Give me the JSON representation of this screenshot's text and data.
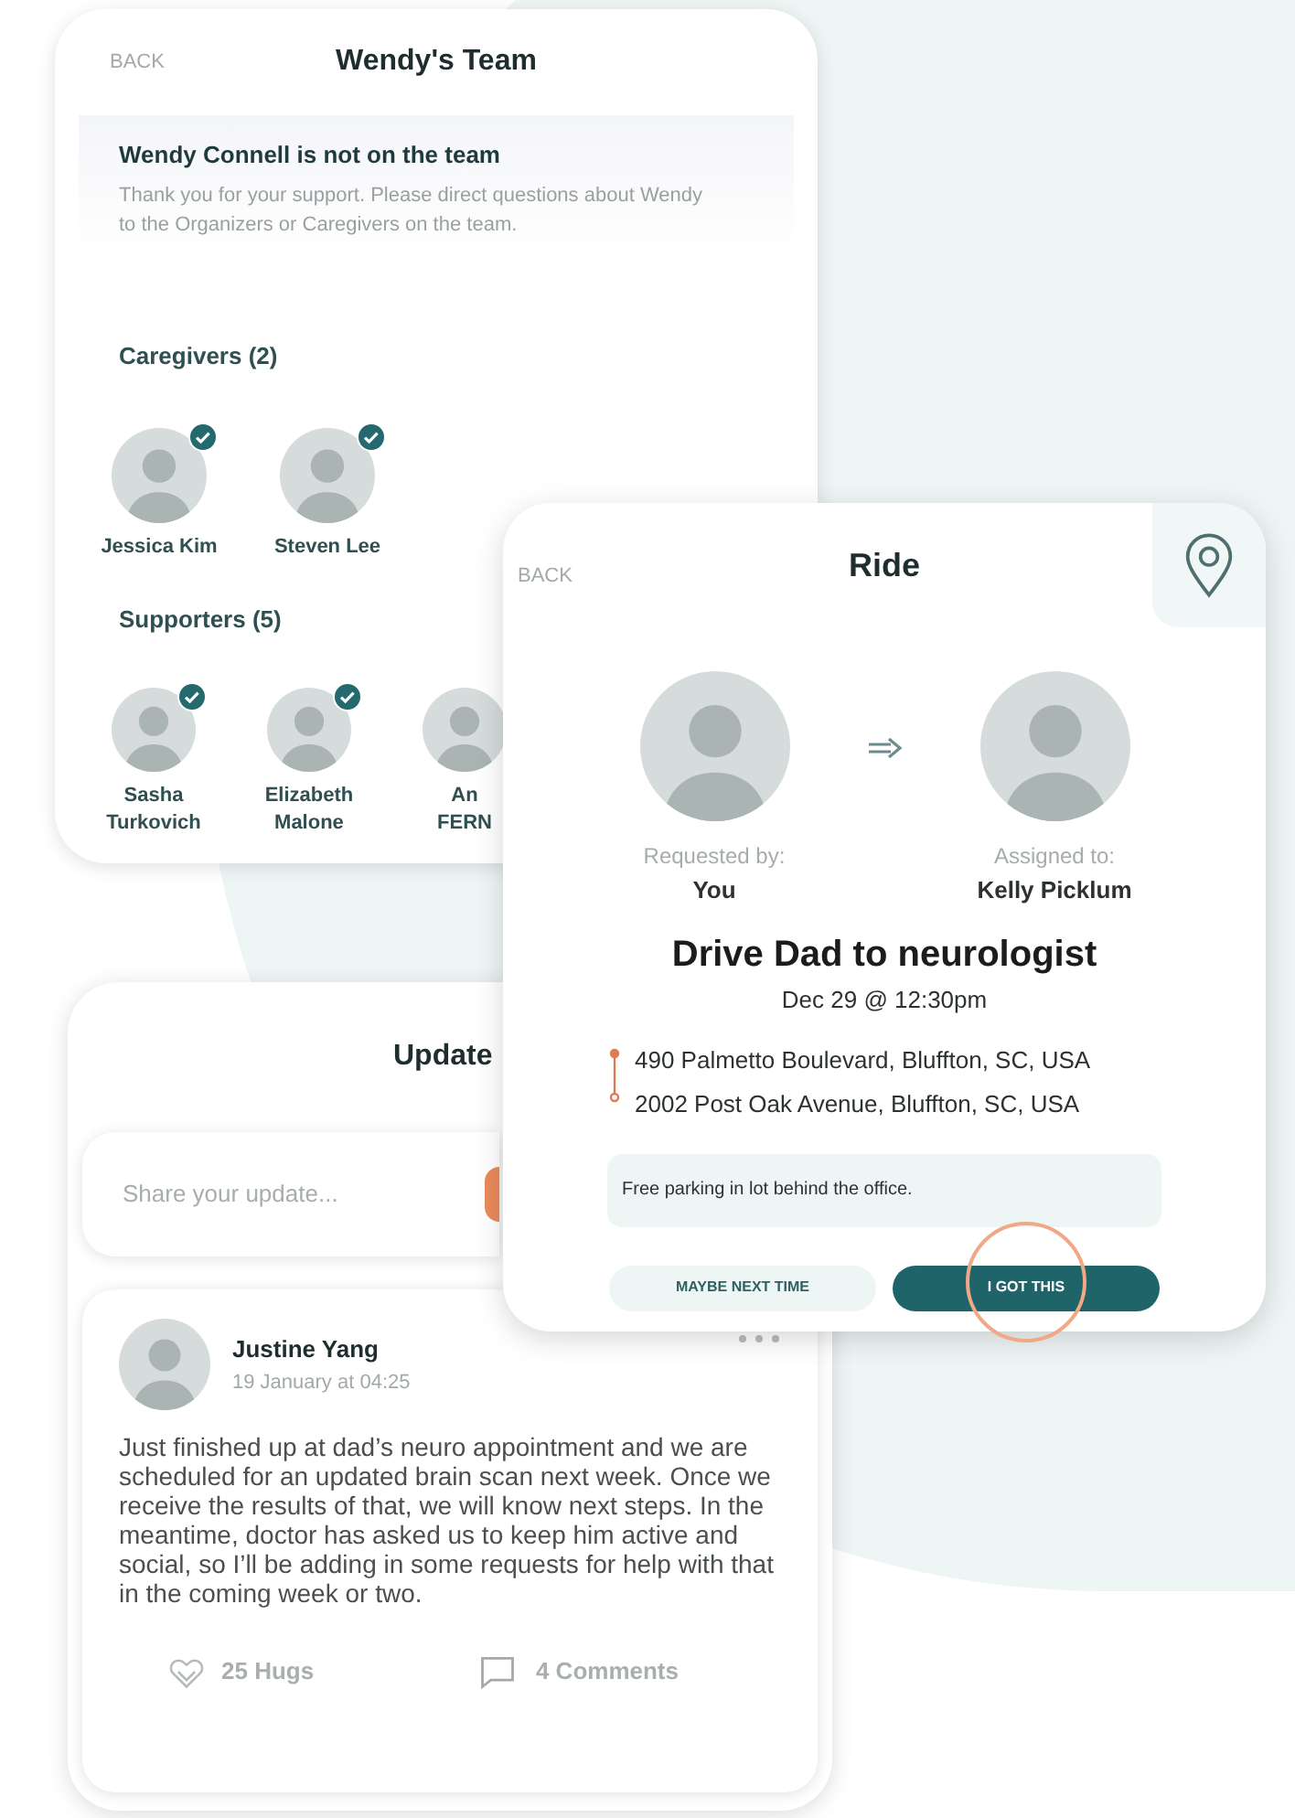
{
  "team_screen": {
    "back": "BACK",
    "title": "Wendy's Team",
    "notice": {
      "heading": "Wendy Connell is not on the team",
      "body": "Thank you for your support. Please direct questions about Wendy to the Organizers or Caregivers on the team."
    },
    "caregivers": {
      "heading": "Caregivers (2)",
      "members": [
        {
          "name_lines": [
            "Jessica Kim"
          ],
          "verified": true
        },
        {
          "name_lines": [
            "Steven Lee"
          ],
          "verified": true
        }
      ]
    },
    "supporters": {
      "heading": "Supporters (5)",
      "members": [
        {
          "name_lines": [
            "Sasha",
            "Turkovich"
          ],
          "verified": true
        },
        {
          "name_lines": [
            "Elizabeth",
            "Malone"
          ],
          "verified": true
        },
        {
          "name_lines": [
            "An",
            "FERN"
          ],
          "verified": false
        }
      ]
    }
  },
  "updates_screen": {
    "title": "Update",
    "composer": {
      "placeholder": "Share your update..."
    },
    "post": {
      "author": "Justine Yang",
      "time": "19 January at 04:25",
      "text": "Just finished up at dad’s neuro appointment and we are scheduled for an updated brain scan next week. Once we receive the results of that, we will know next steps. In the meantime, doctor has asked us to keep him active and social, so I’ll be adding in some requests for help with that in the coming week or two.",
      "hugs": "25 Hugs",
      "comments": "4 Comments"
    }
  },
  "ride_screen": {
    "back": "BACK",
    "title": "Ride",
    "requester": {
      "label": "Requested by:",
      "name": "You"
    },
    "assignee": {
      "label": "Assigned to:",
      "name": "Kelly Picklum"
    },
    "task": "Drive Dad to neurologist",
    "date": "Dec 29 @ 12:30pm",
    "stops": [
      "490 Palmetto Boulevard, Bluffton, SC, USA",
      "2002 Post Oak Avenue, Bluffton, SC, USA"
    ],
    "info": "Free parking in lot behind the office.",
    "buttons": [
      {
        "label": "MAYBE NEXT TIME",
        "kind": "secondary"
      },
      {
        "label": "I GOT THIS",
        "kind": "primary",
        "tapped": true
      }
    ]
  }
}
